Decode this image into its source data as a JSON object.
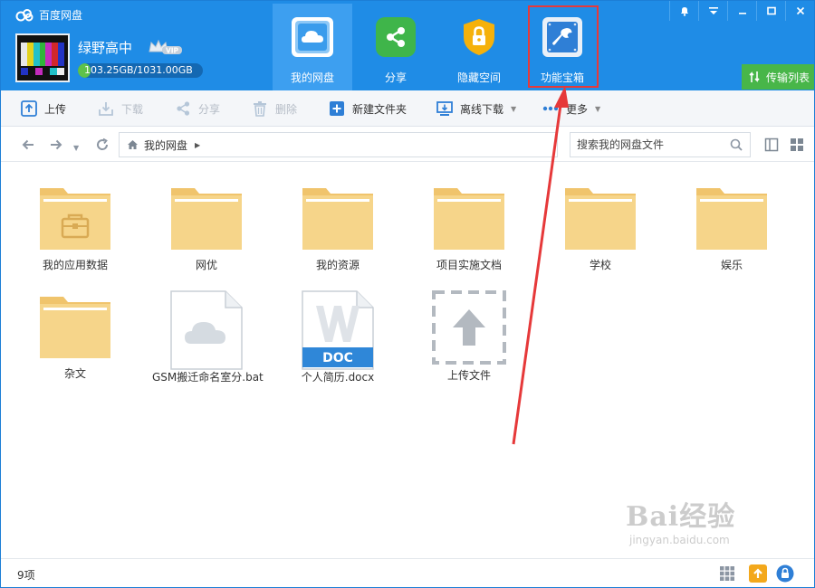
{
  "app": {
    "title": "百度网盘"
  },
  "user": {
    "name": "绿野高中",
    "vip_badge": "VIP",
    "quota_text": "103.25GB/1031.00GB",
    "quota_used_fraction": 0.1
  },
  "nav": {
    "tabs": [
      {
        "label": "我的网盘",
        "icon": "cloud-icon",
        "active": true
      },
      {
        "label": "分享",
        "icon": "share-icon",
        "active": false
      },
      {
        "label": "隐藏空间",
        "icon": "lock-shield-icon",
        "active": false
      },
      {
        "label": "功能宝箱",
        "icon": "wrench-icon",
        "active": false
      }
    ]
  },
  "window": {
    "transfer_label": "传输列表"
  },
  "toolbar": {
    "upload": "上传",
    "download": "下载",
    "share": "分享",
    "delete": "删除",
    "new_folder": "新建文件夹",
    "offline_download": "离线下载",
    "more": "更多"
  },
  "address": {
    "crumb": "我的网盘",
    "search_placeholder": "搜索我的网盘文件"
  },
  "files": [
    {
      "name": "我的应用数据",
      "type": "app-folder"
    },
    {
      "name": "网优",
      "type": "folder"
    },
    {
      "name": "我的资源",
      "type": "folder"
    },
    {
      "name": "项目实施文档",
      "type": "folder"
    },
    {
      "name": "学校",
      "type": "folder"
    },
    {
      "name": "娱乐",
      "type": "folder"
    },
    {
      "name": "杂文",
      "type": "folder"
    },
    {
      "name": "GSM搬迁命名室分.bat",
      "type": "bat-file"
    },
    {
      "name": "个人简历.docx",
      "type": "doc-file",
      "badge": "DOC"
    },
    {
      "name": "上传文件",
      "type": "upload-placeholder"
    }
  ],
  "status": {
    "count": "9项"
  },
  "watermark": {
    "line1": "Bai经验",
    "line2": "jingyan.baidu.com"
  },
  "colors": {
    "header": "#1f8ce6",
    "active_tab": "#3d9ff0",
    "folder": "#f6d58a",
    "transfer": "#48b649",
    "annotation": "#e6393a"
  }
}
